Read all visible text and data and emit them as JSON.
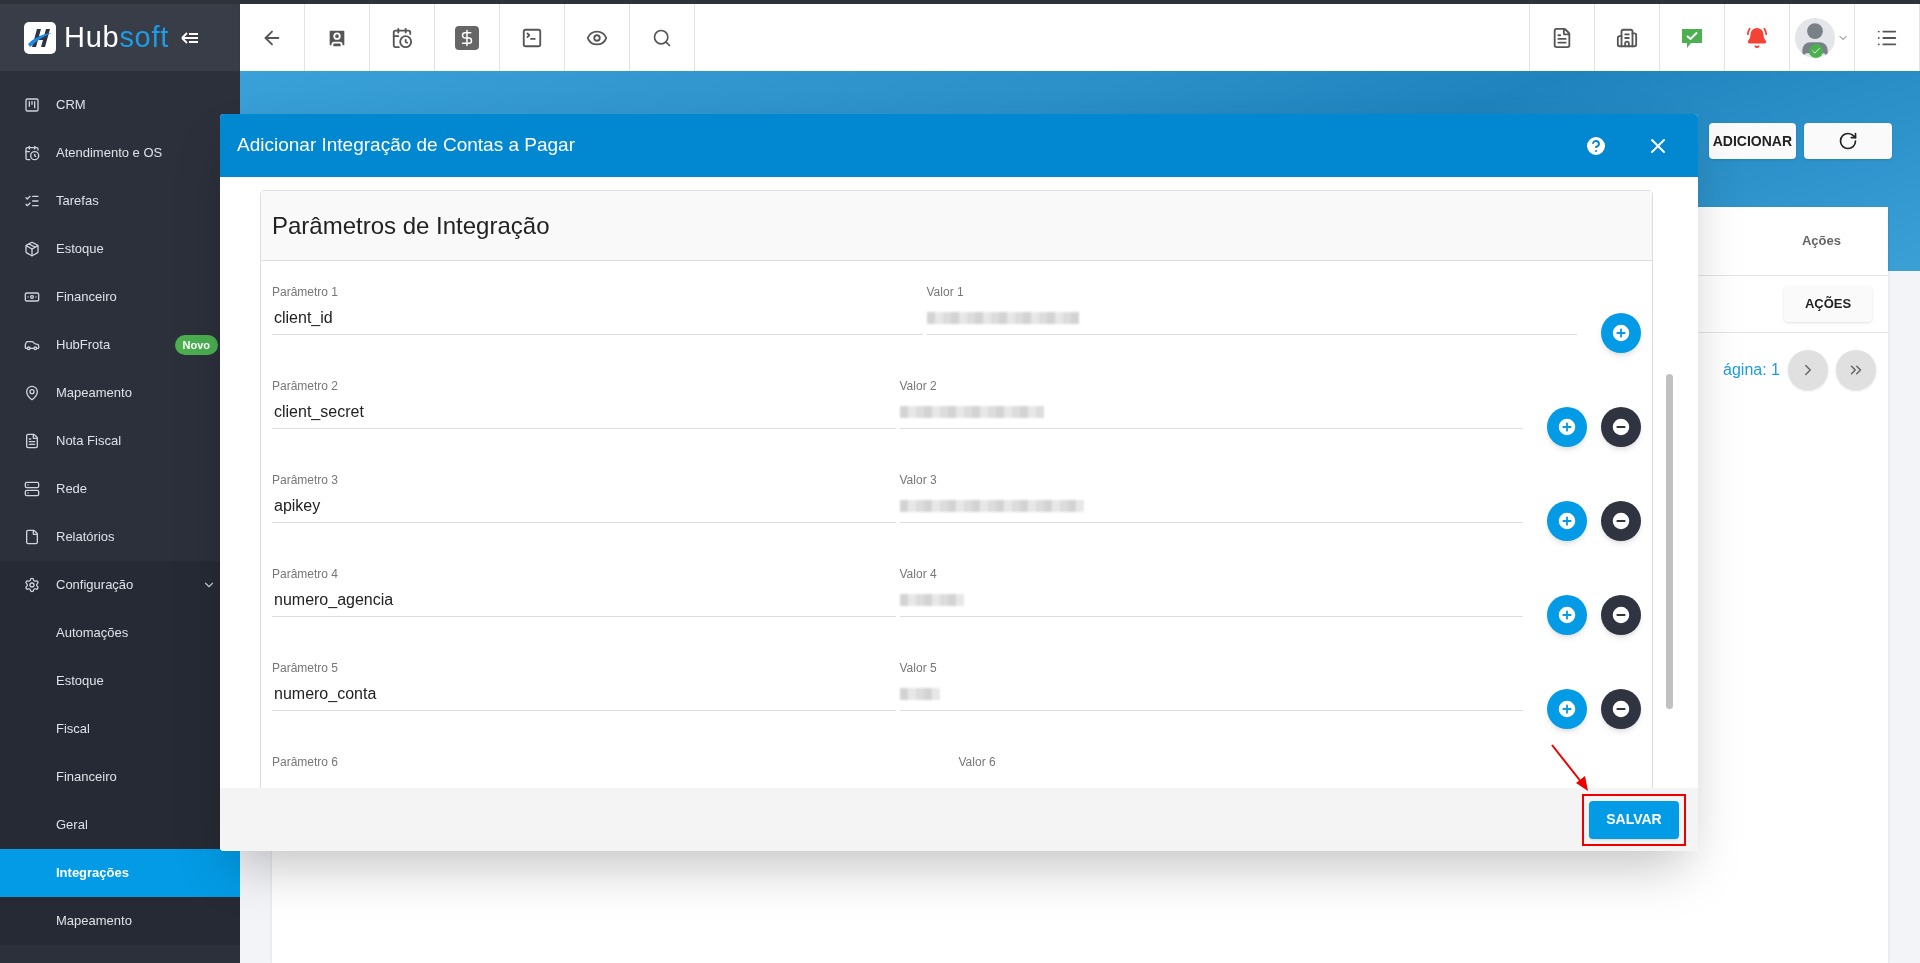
{
  "logo": {
    "text_a": "Hub",
    "text_b": "soft"
  },
  "sidebar": {
    "items": [
      {
        "label": "CRM"
      },
      {
        "label": "Atendimento e OS"
      },
      {
        "label": "Tarefas"
      },
      {
        "label": "Estoque"
      },
      {
        "label": "Financeiro"
      },
      {
        "label": "HubFrota",
        "badge": "Novo"
      },
      {
        "label": "Mapeamento"
      },
      {
        "label": "Nota Fiscal"
      },
      {
        "label": "Rede"
      },
      {
        "label": "Relatórios"
      },
      {
        "label": "Configuração",
        "expanded": true,
        "children": [
          {
            "label": "Automações",
            "selected": false
          },
          {
            "label": "Estoque",
            "selected": false
          },
          {
            "label": "Fiscal",
            "selected": false
          },
          {
            "label": "Financeiro",
            "selected": false
          },
          {
            "label": "Geral",
            "selected": false
          },
          {
            "label": "Integrações",
            "selected": true
          },
          {
            "label": "Mapeamento",
            "selected": false
          }
        ]
      }
    ]
  },
  "page": {
    "add_button": "ADICIONAR",
    "table_header": "Ações",
    "row_action_button": "AÇÕES",
    "pagination": "ágina: 1"
  },
  "modal": {
    "title": "Adicionar Integração de Contas a Pagar",
    "card_title": "Parâmetros de Integração",
    "parameters": [
      {
        "label": "Parâmetro 1",
        "value": "client_id",
        "value_label": "Valor 1",
        "removable": false
      },
      {
        "label": "Parâmetro 2",
        "value": "client_secret",
        "value_label": "Valor 2",
        "removable": true
      },
      {
        "label": "Parâmetro 3",
        "value": "apikey",
        "value_label": "Valor 3",
        "removable": true
      },
      {
        "label": "Parâmetro 4",
        "value": "numero_agencia",
        "value_label": "Valor 4",
        "removable": true
      },
      {
        "label": "Parâmetro 5",
        "value": "numero_conta",
        "value_label": "Valor 5",
        "removable": true
      },
      {
        "label": "Parâmetro 6",
        "value_label": "Valor 6"
      }
    ],
    "save_button": "SALVAR"
  }
}
